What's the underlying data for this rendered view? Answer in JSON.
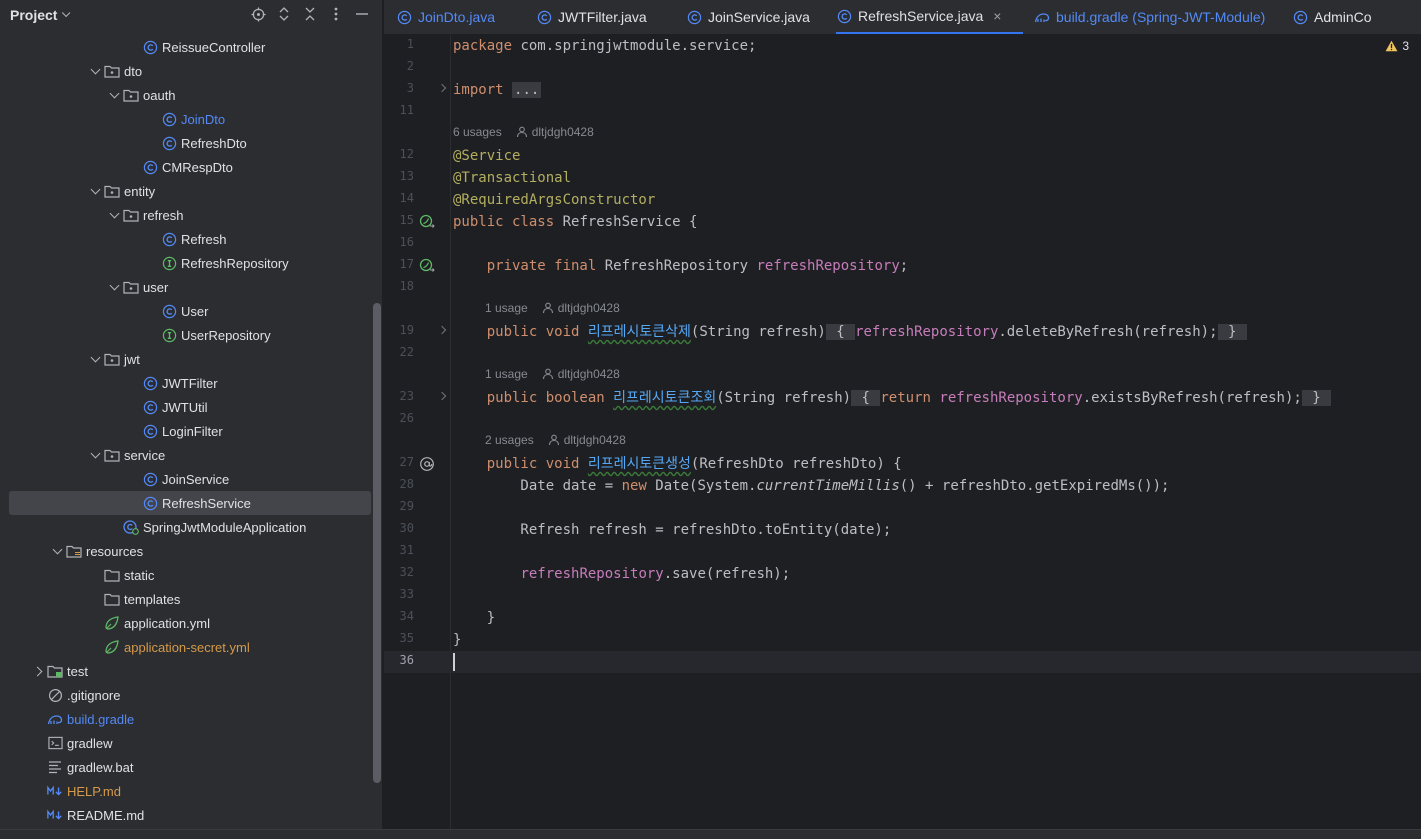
{
  "project_panel": {
    "title": "Project",
    "tree": [
      {
        "label": "ReissueController",
        "icon": "class-icon",
        "indent": 7,
        "twisty": "none"
      },
      {
        "label": "dto",
        "icon": "package-icon",
        "indent": 5,
        "twisty": "down"
      },
      {
        "label": "oauth",
        "icon": "package-icon",
        "indent": 6,
        "twisty": "down"
      },
      {
        "label": "JoinDto",
        "icon": "class-icon",
        "indent": 8,
        "twisty": "none",
        "color": "blue"
      },
      {
        "label": "RefreshDto",
        "icon": "class-icon",
        "indent": 8,
        "twisty": "none"
      },
      {
        "label": "CMRespDto",
        "icon": "class-icon",
        "indent": 7,
        "twisty": "none"
      },
      {
        "label": "entity",
        "icon": "package-icon",
        "indent": 5,
        "twisty": "down"
      },
      {
        "label": "refresh",
        "icon": "package-icon",
        "indent": 6,
        "twisty": "down"
      },
      {
        "label": "Refresh",
        "icon": "class-icon",
        "indent": 8,
        "twisty": "none"
      },
      {
        "label": "RefreshRepository",
        "icon": "interface-icon",
        "indent": 8,
        "twisty": "none"
      },
      {
        "label": "user",
        "icon": "package-icon",
        "indent": 6,
        "twisty": "down"
      },
      {
        "label": "User",
        "icon": "class-icon",
        "indent": 8,
        "twisty": "none"
      },
      {
        "label": "UserRepository",
        "icon": "interface-icon",
        "indent": 8,
        "twisty": "none"
      },
      {
        "label": "jwt",
        "icon": "package-icon",
        "indent": 5,
        "twisty": "down"
      },
      {
        "label": "JWTFilter",
        "icon": "class-icon",
        "indent": 7,
        "twisty": "none"
      },
      {
        "label": "JWTUtil",
        "icon": "class-icon",
        "indent": 7,
        "twisty": "none"
      },
      {
        "label": "LoginFilter",
        "icon": "class-icon",
        "indent": 7,
        "twisty": "none"
      },
      {
        "label": "service",
        "icon": "package-icon",
        "indent": 5,
        "twisty": "down"
      },
      {
        "label": "JoinService",
        "icon": "class-icon",
        "indent": 7,
        "twisty": "none"
      },
      {
        "label": "RefreshService",
        "icon": "class-icon",
        "indent": 7,
        "twisty": "none",
        "selected": true
      },
      {
        "label": "SpringJwtModuleApplication",
        "icon": "spring-app-icon",
        "indent": 6,
        "twisty": "none"
      },
      {
        "label": "resources",
        "icon": "resources-folder-icon",
        "indent": 3,
        "twisty": "down"
      },
      {
        "label": "static",
        "icon": "folder-icon",
        "indent": 5,
        "twisty": "none"
      },
      {
        "label": "templates",
        "icon": "folder-icon",
        "indent": 5,
        "twisty": "none"
      },
      {
        "label": "application.yml",
        "icon": "yaml-icon",
        "indent": 5,
        "twisty": "none"
      },
      {
        "label": "application-secret.yml",
        "icon": "yaml-icon",
        "indent": 5,
        "twisty": "none",
        "color": "orange"
      },
      {
        "label": "test",
        "icon": "test-folder-icon",
        "indent": 2,
        "twisty": "right"
      },
      {
        "label": ".gitignore",
        "icon": "ignore-file-icon",
        "indent": 2,
        "twisty": "none"
      },
      {
        "label": "build.gradle",
        "icon": "gradle-icon",
        "indent": 2,
        "twisty": "none",
        "color": "blue"
      },
      {
        "label": "gradlew",
        "icon": "terminal-icon",
        "indent": 2,
        "twisty": "none"
      },
      {
        "label": "gradlew.bat",
        "icon": "text-file-icon",
        "indent": 2,
        "twisty": "none"
      },
      {
        "label": "HELP.md",
        "icon": "markdown-icon",
        "indent": 2,
        "twisty": "none",
        "color": "orange"
      },
      {
        "label": "README.md",
        "icon": "markdown-icon",
        "indent": 2,
        "twisty": "none"
      }
    ]
  },
  "tabs": [
    {
      "label": "JoinDto.java",
      "icon": "class-icon",
      "color": "blue"
    },
    {
      "label": "JWTFilter.java",
      "icon": "class-icon"
    },
    {
      "label": "JoinService.java",
      "icon": "class-icon"
    },
    {
      "label": "RefreshService.java",
      "icon": "class-icon",
      "active": true,
      "close": "×"
    },
    {
      "label": "build.gradle (Spring-JWT-Module)",
      "icon": "gradle-icon",
      "color": "blue"
    },
    {
      "label": "AdminCo",
      "icon": "class-icon"
    }
  ],
  "editor": {
    "warning_count": "3",
    "code_lines": [
      {
        "num": "1",
        "tokens": [
          [
            "kw",
            "package"
          ],
          [
            "p",
            " com.springjwtmodule.service;"
          ]
        ]
      },
      {
        "num": "2",
        "tokens": []
      },
      {
        "num": "3",
        "fold": true,
        "tokens": [
          [
            "kw",
            "import"
          ],
          [
            "p",
            " "
          ],
          [
            "fblk",
            "..."
          ]
        ]
      },
      {
        "num": "11",
        "tokens": []
      },
      {
        "hint": true,
        "indent": 0,
        "usages": "6 usages",
        "author": "dltjdgh0428"
      },
      {
        "num": "12",
        "tokens": [
          [
            "ann",
            "@Service"
          ]
        ]
      },
      {
        "num": "13",
        "tokens": [
          [
            "ann",
            "@Transactional"
          ]
        ]
      },
      {
        "num": "14",
        "tokens": [
          [
            "ann",
            "@RequiredArgsConstructor"
          ]
        ]
      },
      {
        "num": "15",
        "gutter": "bean-icon",
        "tokens": [
          [
            "kw",
            "public class"
          ],
          [
            "p",
            " RefreshService {"
          ]
        ]
      },
      {
        "num": "16",
        "tokens": []
      },
      {
        "num": "17",
        "gutter": "bean-icon",
        "tokens": [
          [
            "p",
            "    "
          ],
          [
            "kw",
            "private final"
          ],
          [
            "p",
            " RefreshRepository "
          ],
          [
            "fld",
            "refreshRepository"
          ],
          [
            "p",
            ";"
          ]
        ]
      },
      {
        "num": "18",
        "tokens": []
      },
      {
        "hint": true,
        "indent": 4,
        "usages": "1 usage",
        "author": "dltjdgh0428"
      },
      {
        "num": "19",
        "fold": true,
        "tokens": [
          [
            "p",
            "    "
          ],
          [
            "kw",
            "public void"
          ],
          [
            "p",
            " "
          ],
          [
            "meth",
            "리프레시토큰삭제"
          ],
          [
            "p",
            "(String refresh)"
          ],
          [
            "fblk",
            " { "
          ],
          [
            "fld",
            "refreshRepository"
          ],
          [
            "p",
            ".deleteByRefresh(refresh);"
          ],
          [
            "fblk",
            " } "
          ]
        ]
      },
      {
        "num": "22",
        "tokens": []
      },
      {
        "hint": true,
        "indent": 4,
        "usages": "1 usage",
        "author": "dltjdgh0428"
      },
      {
        "num": "23",
        "fold": true,
        "tokens": [
          [
            "p",
            "    "
          ],
          [
            "kw",
            "public boolean"
          ],
          [
            "p",
            " "
          ],
          [
            "meth",
            "리프레시토큰조회"
          ],
          [
            "p",
            "(String refresh)"
          ],
          [
            "fblk",
            " { "
          ],
          [
            "kw",
            "return"
          ],
          [
            "p",
            " "
          ],
          [
            "fld",
            "refreshRepository"
          ],
          [
            "p",
            ".existsByRefresh(refresh);"
          ],
          [
            "fblk",
            " } "
          ]
        ]
      },
      {
        "num": "26",
        "tokens": []
      },
      {
        "hint": true,
        "indent": 4,
        "usages": "2 usages",
        "author": "dltjdgh0428"
      },
      {
        "num": "27",
        "gutter": "at-icon",
        "tokens": [
          [
            "p",
            "    "
          ],
          [
            "kw",
            "public void"
          ],
          [
            "p",
            " "
          ],
          [
            "meth",
            "리프레시토큰생성"
          ],
          [
            "p",
            "(RefreshDto refreshDto) {"
          ]
        ]
      },
      {
        "num": "28",
        "tokens": [
          [
            "p",
            "        Date date = "
          ],
          [
            "kw",
            "new"
          ],
          [
            "p",
            " Date(System."
          ],
          [
            "it",
            "currentTimeMillis"
          ],
          [
            "p",
            "() + refreshDto.getExpiredMs());"
          ]
        ]
      },
      {
        "num": "29",
        "tokens": []
      },
      {
        "num": "30",
        "tokens": [
          [
            "p",
            "        Refresh refresh = refreshDto.toEntity(date);"
          ]
        ]
      },
      {
        "num": "31",
        "tokens": []
      },
      {
        "num": "32",
        "tokens": [
          [
            "p",
            "        "
          ],
          [
            "fld",
            "refreshRepository"
          ],
          [
            "p",
            ".save(refresh);"
          ]
        ]
      },
      {
        "num": "33",
        "tokens": []
      },
      {
        "num": "34",
        "tokens": [
          [
            "p",
            "    }"
          ]
        ]
      },
      {
        "num": "35",
        "tokens": [
          [
            "p",
            "}"
          ]
        ]
      },
      {
        "num": "36",
        "tokens": [],
        "current": true
      }
    ]
  },
  "colors": {
    "accent": "#3574f0",
    "background": "#1e1f22",
    "panel": "#2b2d30",
    "keyword": "#cf8e6d",
    "annotation": "#b3ae60",
    "field": "#c77dbb",
    "method": "#56a8f5"
  }
}
